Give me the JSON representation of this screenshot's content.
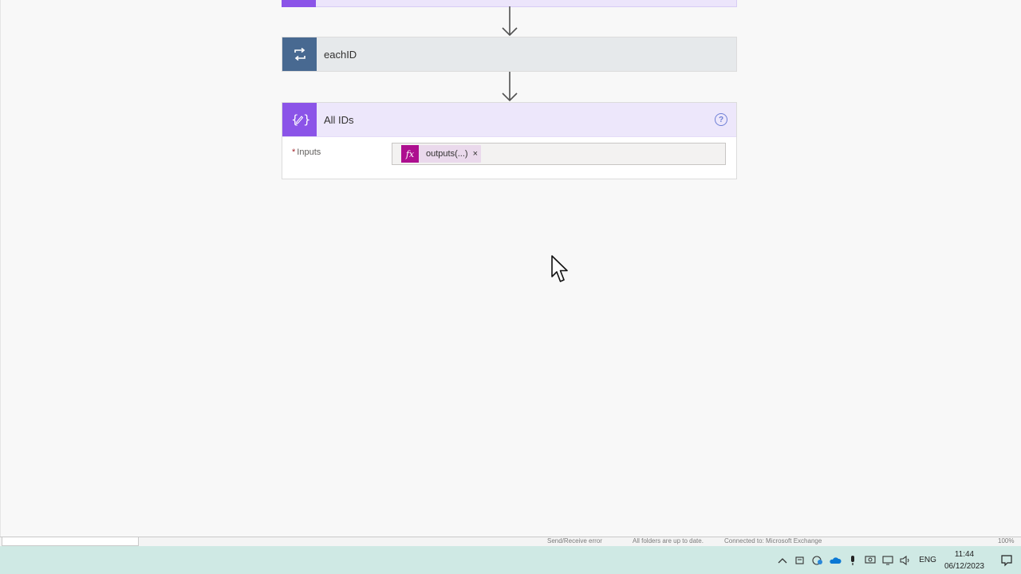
{
  "flow": {
    "each_card": {
      "title": "eachID",
      "icon": "loop-icon"
    },
    "compose_card": {
      "title": "All IDs",
      "icon": "compose-braces-icon",
      "help": "?",
      "field_label": "Inputs",
      "required_mark": "*",
      "token": {
        "icon_text": "fx",
        "label": "outputs(...)",
        "remove": "×"
      }
    }
  },
  "status_bar": {
    "send_receive": "Send/Receive error",
    "folders": "All folders are up to date.",
    "connection": "Connected to: Microsoft Exchange",
    "zoom": "100%"
  },
  "taskbar": {
    "language": "ENG",
    "time": "11:44",
    "date": "06/12/2023"
  },
  "colors": {
    "compose_accent": "#8b54e8",
    "loop_accent": "#486991",
    "expression_token": "#ad0f8f",
    "taskbar": "#cfe9e4"
  }
}
